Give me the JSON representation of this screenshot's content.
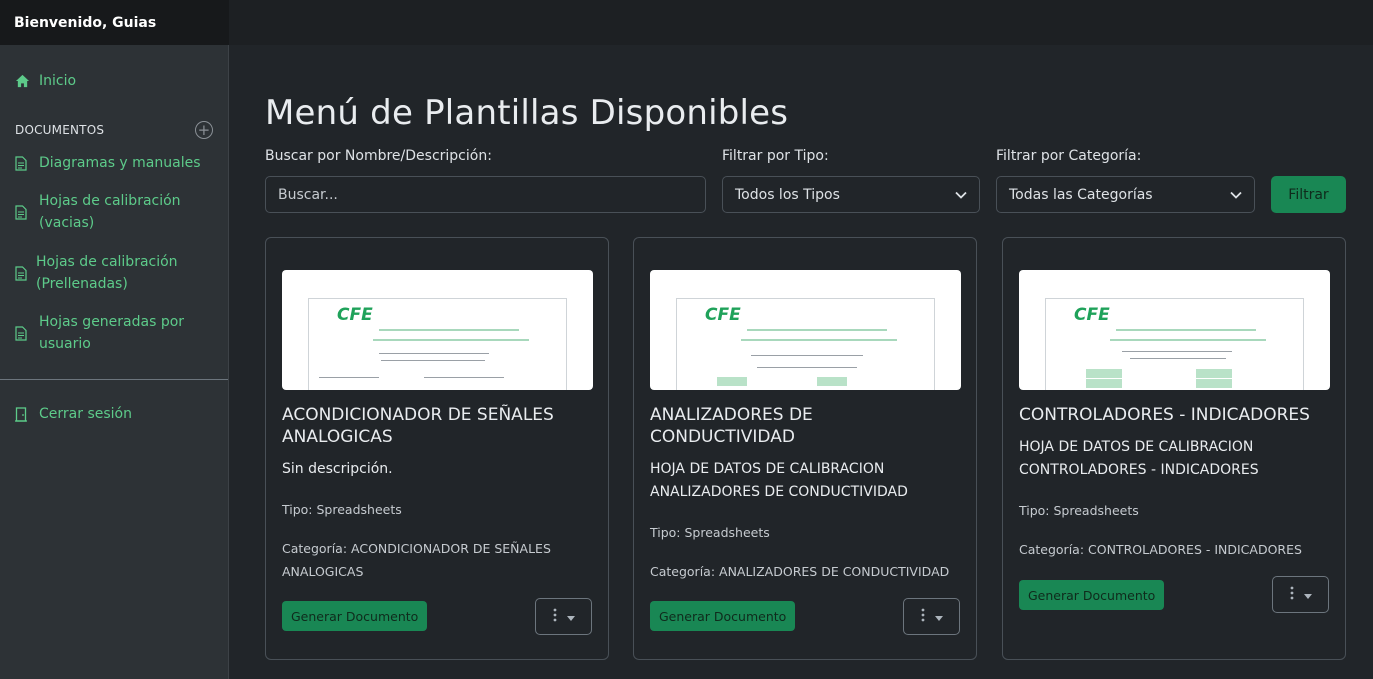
{
  "header": {
    "welcome": "Bienvenido, Guias"
  },
  "sidebar": {
    "home": "Inicio",
    "section_title": "DOCUMENTOS",
    "items": [
      {
        "label": "Diagramas y manuales"
      },
      {
        "label": "Hojas de calibración (vacias)"
      },
      {
        "label": "Hojas de calibración (Prellenadas)"
      },
      {
        "label": "Hojas generadas por usuario"
      }
    ],
    "logout": "Cerrar sesión"
  },
  "main": {
    "title": "Menú de Plantillas Disponibles",
    "search_label": "Buscar por Nombre/Descripción:",
    "search_placeholder": "Buscar...",
    "type_label": "Filtrar por Tipo:",
    "type_value": "Todos los Tipos",
    "category_label": "Filtrar por Categoría:",
    "category_value": "Todas las Categorías",
    "filter_button": "Filtrar"
  },
  "cards": [
    {
      "title": "ACONDICIONADOR DE SEÑALES ANALOGICAS",
      "description": "Sin descripción.",
      "type": "Tipo: Spreadsheets",
      "category": "Categoría: ACONDICIONADOR DE SEÑALES ANALOGICAS",
      "button": "Generar Documento",
      "thumb_logo": "CFE"
    },
    {
      "title": "ANALIZADORES DE CONDUCTIVIDAD",
      "description": "HOJA DE DATOS DE CALIBRACION ANALIZADORES DE CONDUCTIVIDAD",
      "type": "Tipo: Spreadsheets",
      "category": "Categoría: ANALIZADORES DE CONDUCTIVIDAD",
      "button": "Generar Documento",
      "thumb_logo": "CFE"
    },
    {
      "title": "CONTROLADORES - INDICADORES",
      "description": "HOJA DE DATOS DE CALIBRACION CONTROLADORES - INDICADORES",
      "type": "Tipo: Spreadsheets",
      "category": "Categoría: CONTROLADORES - INDICADORES",
      "button": "Generar Documento",
      "thumb_logo": "CFE"
    }
  ],
  "colors": {
    "accent": "#198754",
    "link": "#5dcb8a",
    "background": "#212529",
    "sidebar": "#2d3236"
  }
}
